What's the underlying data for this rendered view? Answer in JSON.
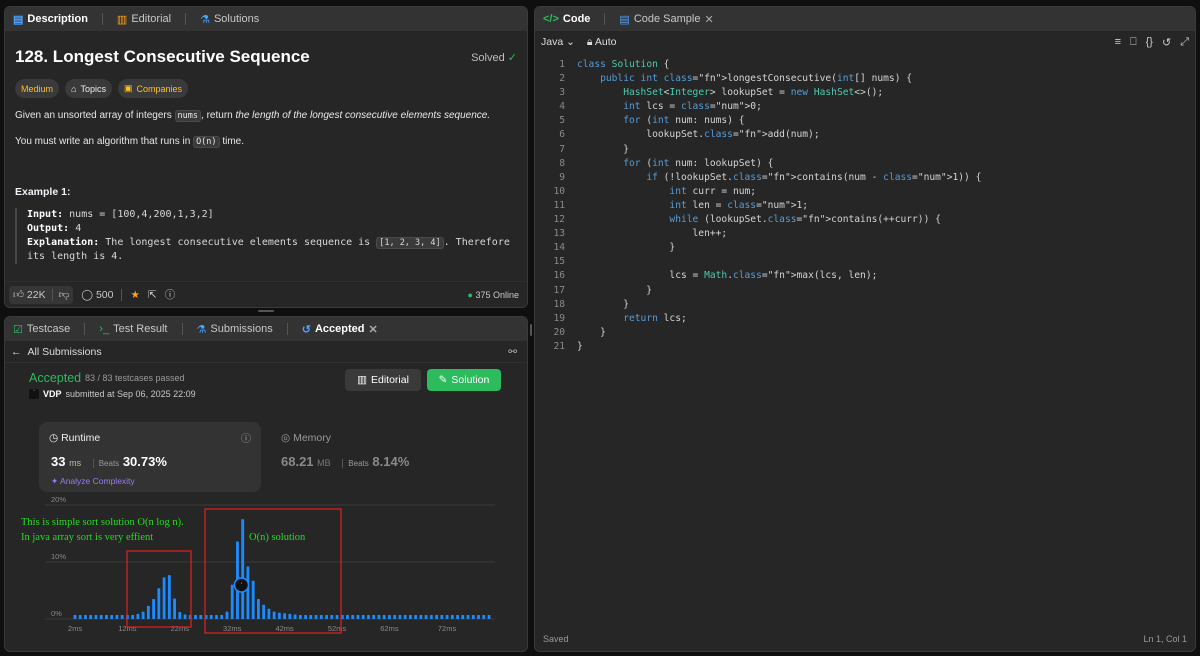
{
  "desc_tabs": [
    {
      "label": "Description",
      "icon": "document-icon"
    },
    {
      "label": "Editorial",
      "icon": "book-icon"
    },
    {
      "label": "Solutions",
      "icon": "flask-icon"
    }
  ],
  "problem": {
    "title": "128. Longest Consecutive Sequence",
    "solved_label": "Solved",
    "chips": [
      "Medium",
      "Topics",
      "Companies"
    ],
    "statement_pre": "Given an unsorted array of integers",
    "statement_code": "nums",
    "statement_mid": ", return",
    "statement_em": "the length of the longest consecutive elements sequence.",
    "req_pre": "You must write an algorithm that runs in",
    "req_code": "O(n)",
    "req_post": "time.",
    "example_title": "Example 1:",
    "input_label": "Input:",
    "input_value": "nums = [100,4,200,1,3,2]",
    "output_label": "Output:",
    "output_value": "4",
    "expl_label": "Explanation:",
    "expl_pre": "The longest consecutive elements sequence is",
    "expl_code": "[1, 2, 3, 4]",
    "expl_post": ". Therefore",
    "expl_line2": "its length is 4."
  },
  "desc_footer": {
    "likes": "22K",
    "comments": "500",
    "online": "375 Online"
  },
  "result_tabs": [
    {
      "label": "Testcase",
      "icon": "check-square-icon"
    },
    {
      "label": "Test Result",
      "icon": "terminal-icon"
    },
    {
      "label": "Submissions",
      "icon": "flask-icon"
    },
    {
      "label": "Accepted",
      "icon": "history-icon"
    }
  ],
  "submission": {
    "back_label": "All Submissions",
    "status": "Accepted",
    "passed": "83 / 83 testcases passed",
    "user": "VDP",
    "submitted": "submitted at Sep 06, 2025 22:09",
    "editorial_btn": "Editorial",
    "solution_btn": "Solution",
    "runtime_label": "Runtime",
    "runtime_value": "33",
    "runtime_unit": "ms",
    "beats_label": "Beats",
    "runtime_beats": "30.73%",
    "analyze_label": "Analyze Complexity",
    "memory_label": "Memory",
    "memory_value": "68.21",
    "memory_unit": "MB",
    "memory_beats": "8.14%"
  },
  "annotations": {
    "sort_note_line1": "This is simple sort solution O(n log n).",
    "sort_note_line2": "In java array sort is very effient",
    "on_note": "O(n) solution"
  },
  "chart_data": {
    "type": "bar",
    "title": "",
    "xlabel": "",
    "ylabel": "",
    "x_ticks": [
      "2ms",
      "12ms",
      "22ms",
      "32ms",
      "42ms",
      "52ms",
      "62ms",
      "72ms"
    ],
    "y_ticks": [
      "0%",
      "10%",
      "20%"
    ],
    "ylim": [
      0,
      20
    ],
    "x": [
      2,
      3,
      4,
      5,
      6,
      7,
      8,
      9,
      10,
      11,
      12,
      13,
      14,
      15,
      16,
      17,
      18,
      19,
      20,
      21,
      22,
      23,
      24,
      25,
      26,
      27,
      28,
      29,
      30,
      31,
      32,
      33,
      34,
      35,
      36,
      37,
      38,
      39,
      40,
      41,
      42,
      43,
      44,
      45,
      46,
      47,
      48,
      49,
      50,
      51,
      52,
      53,
      54,
      55,
      56,
      57,
      58,
      59,
      60,
      61,
      62,
      63,
      64,
      65,
      65,
      66,
      67,
      68,
      69,
      70,
      71,
      72,
      73,
      74,
      75,
      76,
      77,
      78,
      79,
      80
    ],
    "values": [
      0.7,
      0.7,
      0.7,
      0.7,
      0.7,
      0.7,
      0.7,
      0.7,
      0.7,
      0.7,
      0.7,
      0.7,
      0.9,
      1.3,
      2.3,
      3.5,
      5.4,
      7.3,
      7.7,
      3.6,
      1.2,
      0.8,
      0.7,
      0.7,
      0.7,
      0.7,
      0.7,
      0.7,
      0.7,
      1.3,
      6.0,
      13.6,
      17.5,
      9.2,
      6.7,
      3.5,
      2.5,
      1.8,
      1.3,
      1.1,
      1.0,
      0.9,
      0.8,
      0.7,
      0.7,
      0.7,
      0.7,
      0.7,
      0.7,
      0.7,
      0.7,
      0.7,
      0.7,
      0.7,
      0.7,
      0.7,
      0.7,
      0.7,
      0.7,
      0.7,
      0.7,
      0.7,
      0.7,
      0.7,
      0.7,
      0.7,
      0.7,
      0.7,
      0.7,
      0.7,
      0.7,
      0.7,
      0.7,
      0.7,
      0.7,
      0.7,
      0.7,
      0.7,
      0.7,
      0.7
    ],
    "highlight_x": 33,
    "color": "#1a8cff"
  },
  "code_tabs": [
    {
      "label": "Code",
      "icon": "code-icon"
    },
    {
      "label": "Code Sample",
      "icon": "file-icon"
    }
  ],
  "editor": {
    "language": "Java",
    "auto_label": "Auto",
    "status_left": "Saved",
    "status_right": "Ln 1, Col 1",
    "lines": [
      "class Solution {",
      "    public int longestConsecutive(int[] nums) {",
      "        HashSet<Integer> lookupSet = new HashSet<>();",
      "        int lcs = 0;",
      "        for (int num: nums) {",
      "            lookupSet.add(num);",
      "        }",
      "        for (int num: lookupSet) {",
      "            if (!lookupSet.contains(num - 1)) {",
      "                int curr = num;",
      "                int len = 1;",
      "                while (lookupSet.contains(++curr)) {",
      "                    len++;",
      "                }",
      "",
      "                lcs = Math.max(lcs, len);",
      "            }",
      "        }",
      "        return lcs;",
      "    }",
      "}"
    ]
  },
  "colors": {
    "accent_green": "#2cbb5d",
    "medium": "#ffc01e",
    "annotation_text": "#22dd22",
    "annotation_box": "#e02020"
  }
}
